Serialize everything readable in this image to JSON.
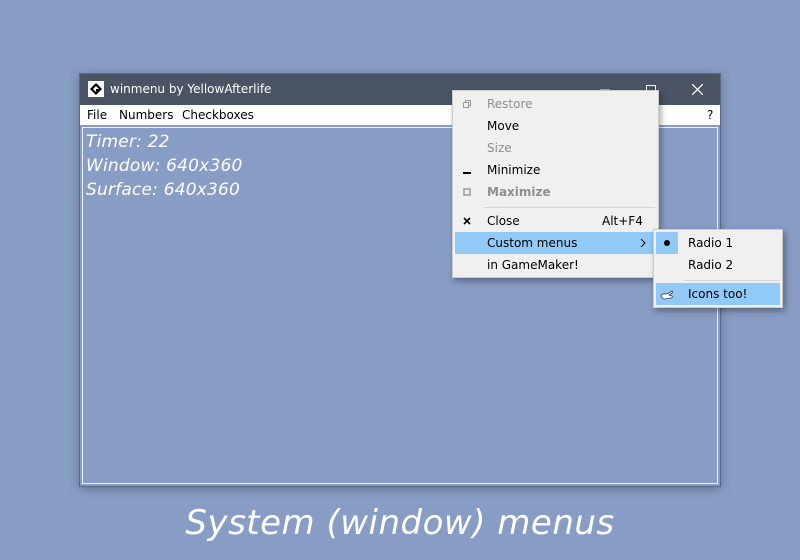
{
  "window": {
    "title": "winmenu by YellowAfterlife",
    "menubar": {
      "items": [
        "File",
        "Numbers",
        "Checkboxes"
      ],
      "help": "?"
    },
    "overlay": {
      "timer": "Timer: 22",
      "window_size": "Window: 640x360",
      "surface_size": "Surface: 640x360"
    }
  },
  "system_menu": {
    "items": [
      {
        "label": "Restore",
        "icon": "restore-icon",
        "disabled": true
      },
      {
        "label": "Move"
      },
      {
        "label": "Size",
        "disabled": true
      },
      {
        "label": "Minimize",
        "icon": "minimize-icon"
      },
      {
        "label": "Maximize",
        "icon": "maximize-icon",
        "disabled": true,
        "bold": true
      },
      {
        "label": "Close",
        "icon": "close-icon",
        "accel": "Alt+F4"
      },
      {
        "label": "Custom menus",
        "submenu": true,
        "highlighted": true
      },
      {
        "label": "in GameMaker!"
      }
    ]
  },
  "submenu": {
    "items": [
      {
        "label": "Radio 1",
        "checked": true,
        "icon": "radio-dot-icon"
      },
      {
        "label": "Radio 2"
      },
      {
        "label": "Icons too!",
        "icon": "hand-icon",
        "highlighted": true
      }
    ]
  },
  "caption": "System (window) menus",
  "colors": {
    "background": "#889dc5",
    "titlebar": "#4a5465",
    "menu_background": "#f0f0f0",
    "highlight": "#91c9f7",
    "disabled_text": "#8f8f8f"
  }
}
